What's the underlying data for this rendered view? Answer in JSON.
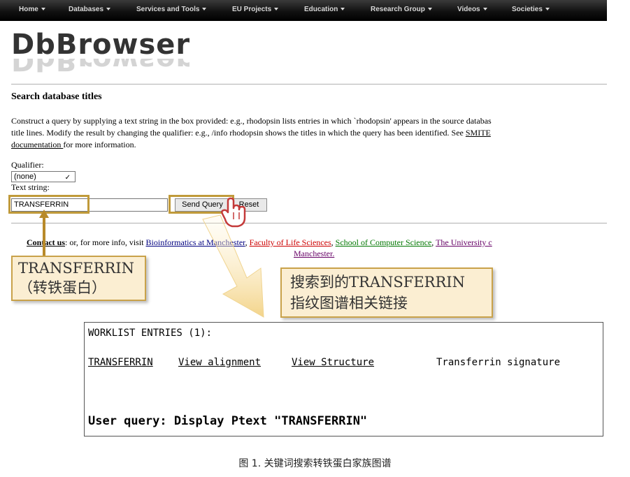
{
  "nav": [
    {
      "label": "Home"
    },
    {
      "label": "Databases"
    },
    {
      "label": "Services and Tools"
    },
    {
      "label": "EU Projects"
    },
    {
      "label": "Education"
    },
    {
      "label": "Research Group"
    },
    {
      "label": "Videos"
    },
    {
      "label": "Societies"
    }
  ],
  "logo": {
    "text": "DbBrowser"
  },
  "page": {
    "title": "Search database titles",
    "intro_line1": "Construct a query by supplying a text string in the box provided: e.g., rhodopsin lists entries in which `rhodopsin' appears in the source databas",
    "intro_line2": "title lines. Modify the result by changing the qualifier: e.g., /info rhodopsin shows the titles in which the query has been identified. See ",
    "intro_link1": "SMITE",
    "intro_link2": "documentation ",
    "intro_line3": "for more information."
  },
  "form": {
    "qualifier_label": "Qualifier:",
    "qualifier_value": "(none)",
    "text_label": "Text string:",
    "text_value": "TRANSFERRIN",
    "send_label": "Send Query",
    "reset_label": "Reset"
  },
  "contact": {
    "contact_link": "Contact us",
    "text": ": or, for more info, visit ",
    "link1": "Bioinformatics at Manchester",
    "link2": "Faculty of Life Sciences",
    "link3": "School of Computer Science",
    "link4": "The University c",
    "link4_cont": "Manchester."
  },
  "callouts": {
    "left_line1": "TRANSFERRIN",
    "left_line2": "（转铁蛋白）",
    "right_line1": "搜索到的TRANSFERRIN",
    "right_line2": "指纹图谱相关链接"
  },
  "result": {
    "header": "WORKLIST ENTRIES (1):",
    "link1": "TRANSFERRIN",
    "link2": "View alignment",
    "link3": "View Structure",
    "signature": "Transferrin signature",
    "query": "User query: Display Ptext \"TRANSFERRIN\""
  },
  "caption": "图 1. 关键词搜索转铁蛋白家族图谱",
  "colors": {
    "highlight_border": "#c09a3a",
    "callout_bg": "#fbeed2",
    "nav_bg": "#111111"
  }
}
